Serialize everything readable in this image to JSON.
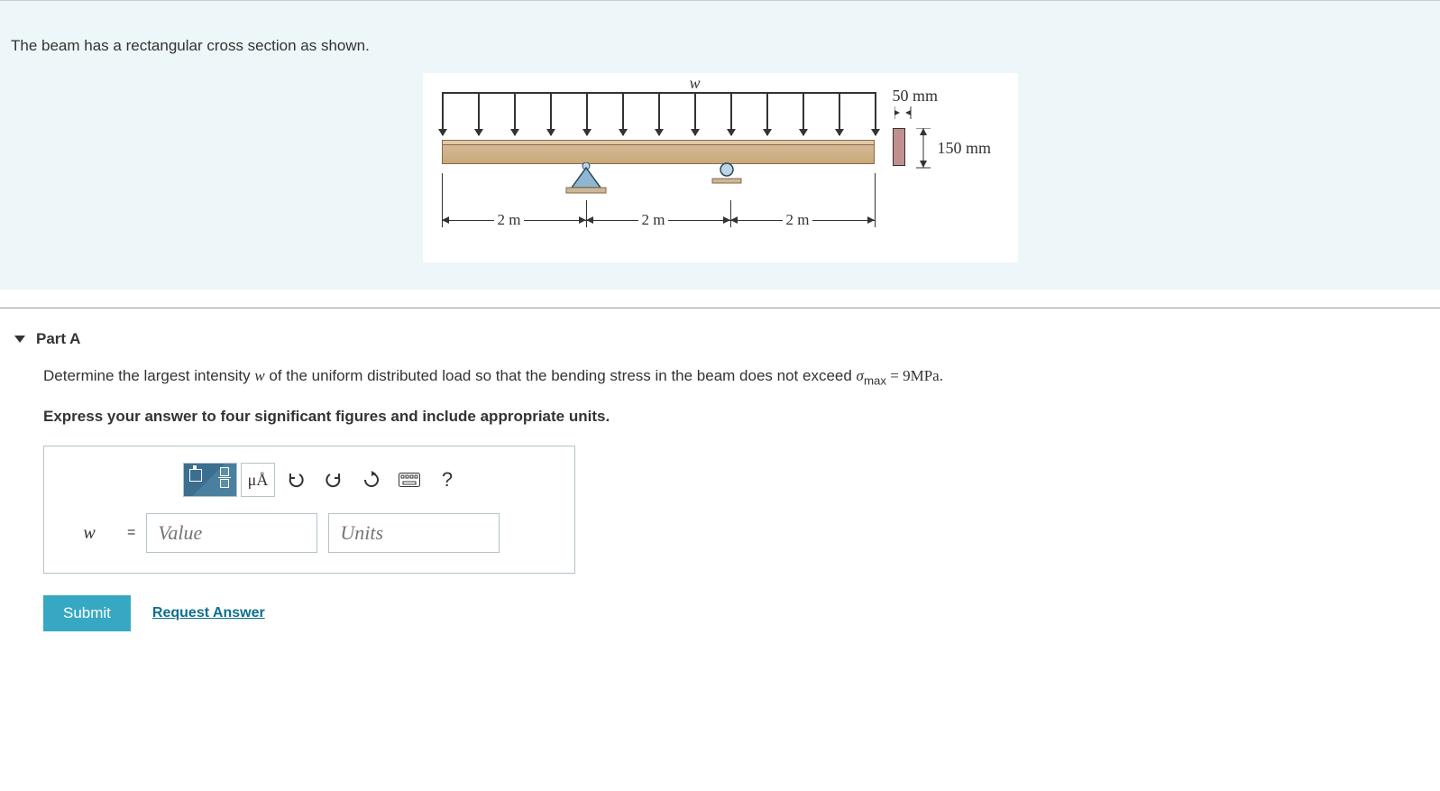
{
  "problem": {
    "intro": "The beam has a rectangular cross section as shown.",
    "figure": {
      "load_label": "w",
      "span1": "2 m",
      "span2": "2 m",
      "span3": "2 m",
      "width_label": "50 mm",
      "height_label": "150 mm"
    }
  },
  "part": {
    "heading": "Part A",
    "question_pre": "Determine the largest intensity ",
    "question_var": "w",
    "question_mid": " of the uniform distributed load so that the bending stress in the beam does not exceed ",
    "sigma": "σ",
    "sigma_sub": "max",
    "eq_text": " = 9MPa.",
    "instruction": "Express your answer to four significant figures and include appropriate units."
  },
  "toolbar": {
    "mu_label": "μÅ",
    "help_label": "?"
  },
  "answer": {
    "var": "w",
    "eq": "=",
    "value_placeholder": "Value",
    "units_placeholder": "Units"
  },
  "actions": {
    "submit": "Submit",
    "request": "Request Answer"
  }
}
